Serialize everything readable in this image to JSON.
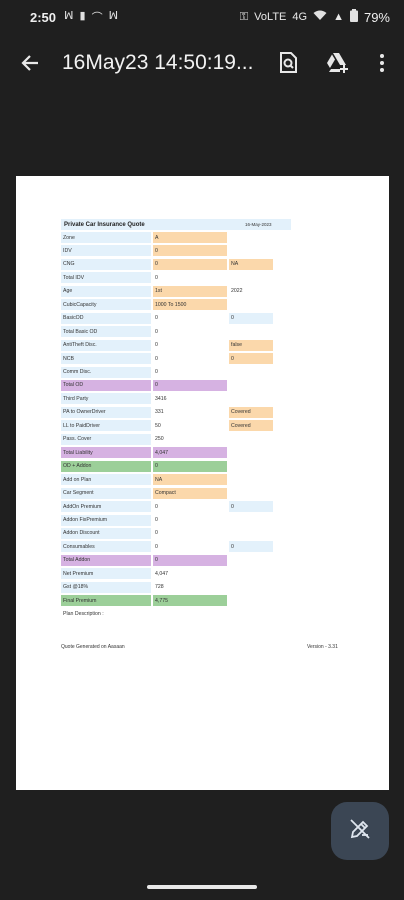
{
  "status_bar": {
    "time": "2:50",
    "left_icons": [
      "ꟽ",
      "▮",
      "⌒",
      "ꟽ"
    ],
    "right_labels": [
      "⚿",
      "VoLTE",
      "4G",
      "▲"
    ],
    "battery": "79%"
  },
  "app_bar": {
    "title": "16May23 14:50:19...",
    "icons": [
      "back-arrow-icon",
      "find-in-page-icon",
      "drive-add-icon",
      "more-vert-icon"
    ]
  },
  "sheet": {
    "header_title": "Private Car Insurance Quote",
    "header_date": "16-May-2023",
    "rows": [
      {
        "label": "Zone",
        "value": "A",
        "note": ""
      },
      {
        "label": "IDV",
        "value": "0",
        "note": ""
      },
      {
        "label": "CNG",
        "value": "0",
        "note": "NA"
      },
      {
        "label": "Total IDV",
        "value": "0",
        "note": ""
      },
      {
        "label": "Age",
        "value": "1st",
        "note": "2022"
      },
      {
        "label": "CubicCapacity",
        "value": "1000 To 1500",
        "note": ""
      },
      {
        "label": "BasicOD",
        "value": "0",
        "note": "0"
      },
      {
        "label": "Total Basic OD",
        "value": "0",
        "note": ""
      },
      {
        "label": "AntiTheft Disc.",
        "value": "0",
        "note": "false"
      },
      {
        "label": "NCB",
        "value": "0",
        "note": "0"
      },
      {
        "label": "Comm Disc.",
        "value": "0",
        "note": ""
      },
      {
        "label": "Total OD",
        "value": "0",
        "note": ""
      },
      {
        "label": "Third Party",
        "value": "3416",
        "note": ""
      },
      {
        "label": "PA to OwnerDriver",
        "value": "331",
        "note": "Covered"
      },
      {
        "label": "LL to PaidDriver",
        "value": "50",
        "note": "Covered"
      },
      {
        "label": "Pass. Cover",
        "value": "250",
        "note": ""
      },
      {
        "label": "Total Liability",
        "value": "4,047",
        "note": ""
      },
      {
        "label": "OD + Addon",
        "value": "0",
        "note": ""
      },
      {
        "label": "Add on Plan",
        "value": "NA",
        "note": ""
      },
      {
        "label": "Car Segment",
        "value": "Compact",
        "note": ""
      },
      {
        "label": "AddOn Premium",
        "value": "0",
        "note": "0"
      },
      {
        "label": "Addon FixPremium",
        "value": "0",
        "note": ""
      },
      {
        "label": "Addon Discount",
        "value": "0",
        "note": ""
      },
      {
        "label": "Consumables",
        "value": "0",
        "note": "0"
      },
      {
        "label": "Total Addon",
        "value": "0",
        "note": ""
      },
      {
        "label": "Net Premium",
        "value": "4,047",
        "note": ""
      },
      {
        "label": "Gst @18%",
        "value": "728",
        "note": ""
      },
      {
        "label": "Final Premium",
        "value": "4,775",
        "note": ""
      },
      {
        "label": "Plan Description :",
        "value": "",
        "note": ""
      }
    ],
    "footer_left": "Quote Generated on Aasaan",
    "footer_right": "Version - 3.31"
  },
  "fab": {
    "icon": "edit-pencil-icon"
  },
  "colors": {
    "background": "#1f1f1f",
    "label_blue": "#e3f1fb",
    "value_orange": "#fbd8ab",
    "total_purple": "#d6b2e2",
    "total_green": "#9ccf99",
    "fab": "#3b4654"
  }
}
